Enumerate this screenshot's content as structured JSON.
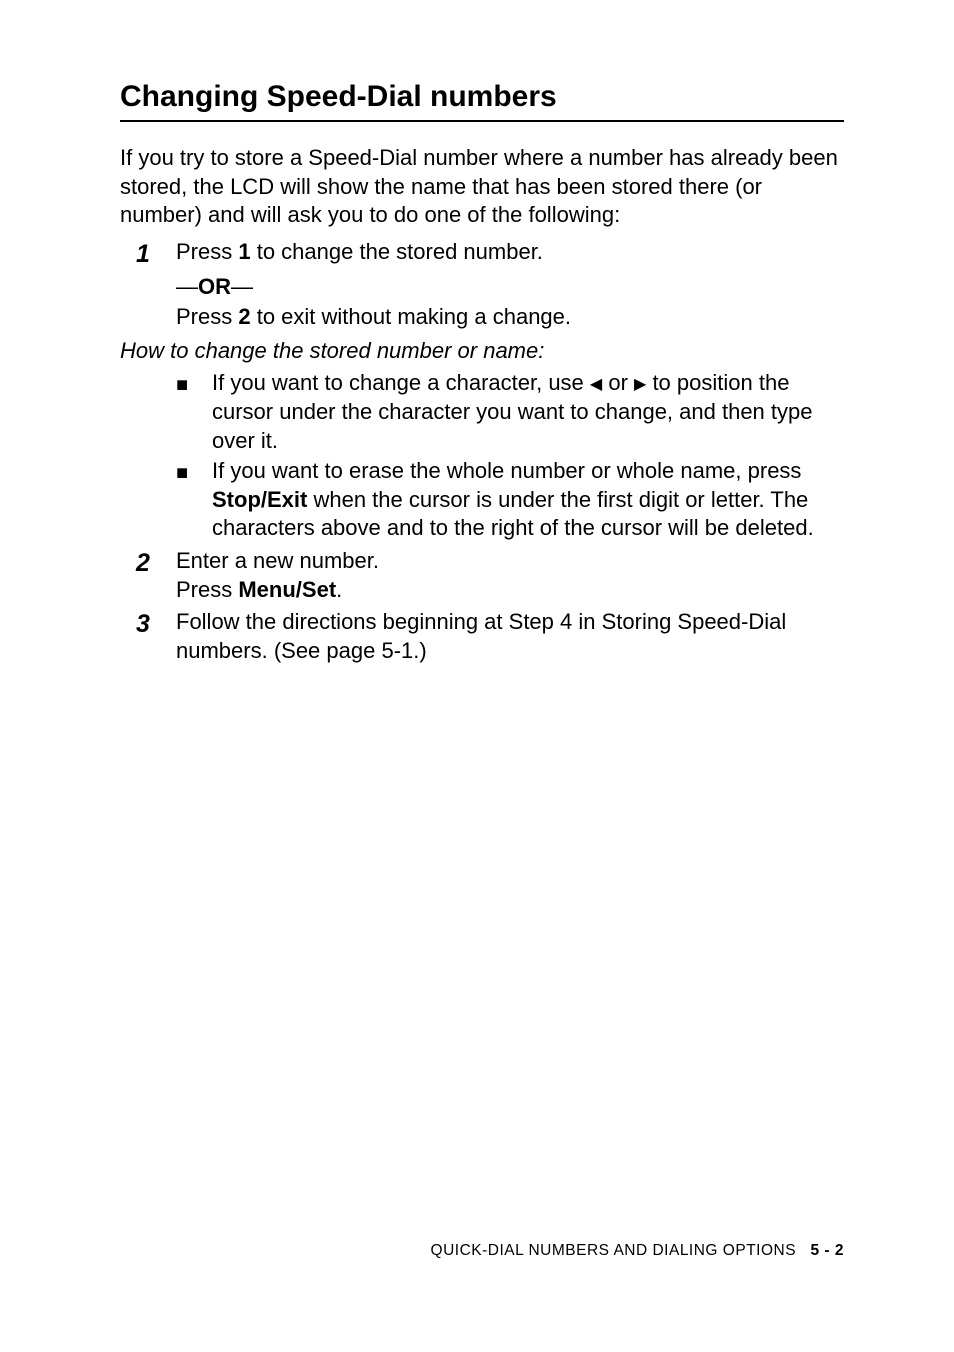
{
  "heading": "Changing Speed-Dial numbers",
  "intro": "If you try to store a Speed-Dial number where a number has already been stored, the LCD will show the name that has been stored there (or number) and will ask you to do one of the following:",
  "step1": {
    "num": "1",
    "text_pre": "Press ",
    "text_bold": "1",
    "text_post": " to change the stored number."
  },
  "or": {
    "dash1": "—",
    "bold": "OR",
    "dash2": "—"
  },
  "press2": {
    "pre": "Press ",
    "bold": "2",
    "post": " to exit without making a change."
  },
  "howto": "How to change the stored number or name:",
  "bullet1": {
    "marker": "■",
    "pre": "If you want to change a character, use ",
    "left": "◀",
    "mid": " or ",
    "right": "▶",
    "post": " to position the cursor under the character you want to change, and then type over it."
  },
  "bullet2": {
    "marker": "■",
    "pre": "If you want to erase the whole number or whole name, press ",
    "bold": "Stop/Exit",
    "post": " when the cursor is under the first digit or letter. The characters above and to the right of the cursor will be deleted."
  },
  "step2": {
    "num": "2",
    "line1": "Enter a new number.",
    "line2_pre": "Press ",
    "line2_bold": "Menu/Set",
    "line2_post": "."
  },
  "step3": {
    "num": "3",
    "text": "Follow the directions beginning at Step 4 in Storing Speed-Dial numbers. (See page 5-1.)"
  },
  "footer": {
    "label": "QUICK-DIAL NUMBERS AND DIALING OPTIONS",
    "page": "5 - 2"
  }
}
